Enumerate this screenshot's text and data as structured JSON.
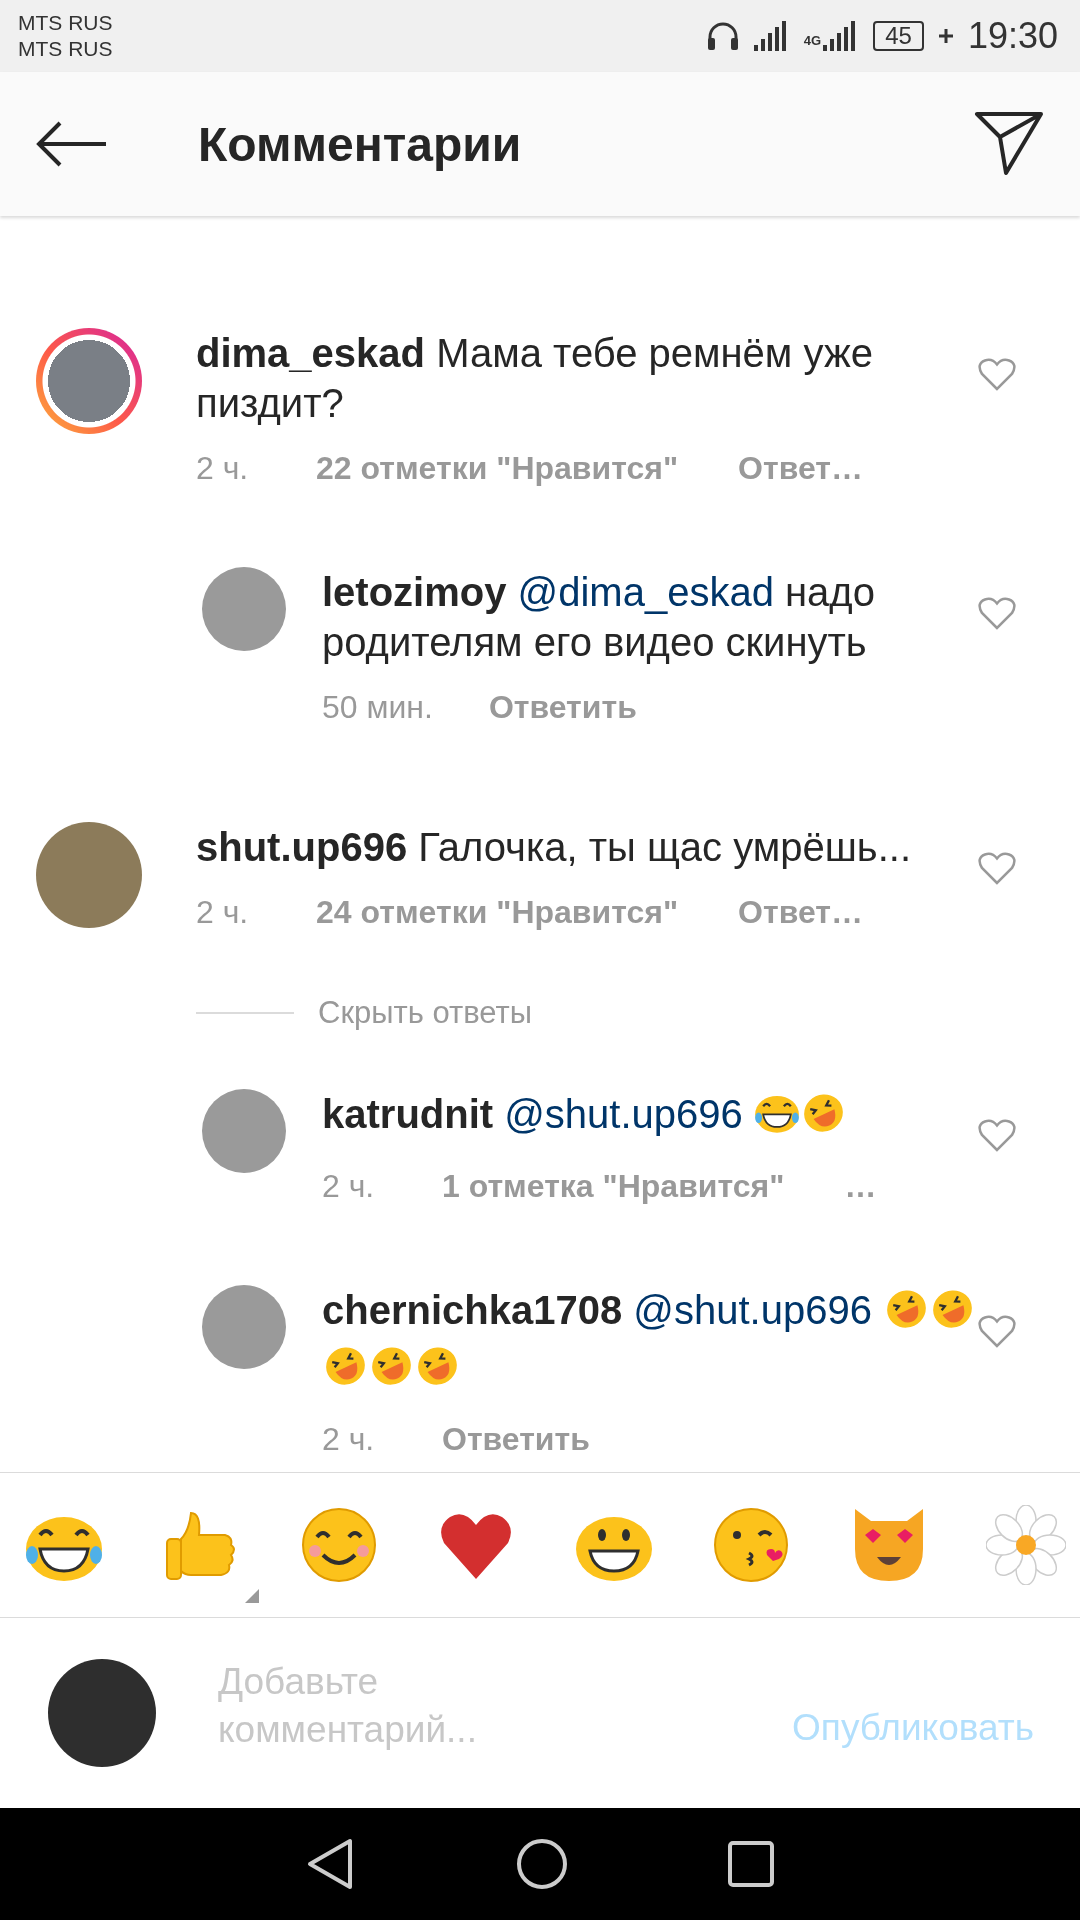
{
  "status_bar": {
    "carriers": [
      "MTS RUS",
      "MTS RUS"
    ],
    "network_type": "4G",
    "battery": "45",
    "time": "19:30"
  },
  "header": {
    "title": "Комментарии"
  },
  "comments": [
    {
      "user": "dima_eskad",
      "text": "Мама тебе ремнём уже пиздит?",
      "time": "2 ч.",
      "likes": "22 отметки \"Нравится\"",
      "reply": "Ответ…",
      "has_story": true,
      "replies": [
        {
          "user": "letozimoy",
          "mention": "@dima_eskad",
          "text": "надо родителям его видео скинуть",
          "time": "50 мин.",
          "reply": "Ответить"
        }
      ]
    },
    {
      "user": "shut.up696",
      "text": "Галочка, ты щас умрёшь...",
      "time": "2 ч.",
      "likes": "24 отметки \"Нравится\"",
      "reply": "Ответ…",
      "has_story": false,
      "hide_replies": "Скрыть ответы",
      "replies": [
        {
          "user": "katrudnit",
          "mention": "@shut.up696",
          "emojis": [
            {
              "kind": "tears-of-joy"
            },
            {
              "kind": "rolling-laughing"
            }
          ],
          "time": "2 ч.",
          "likes": "1 отметка \"Нравится\"",
          "reply": "…"
        },
        {
          "user": "chernichka1708",
          "mention": "@shut.up696",
          "emojis": [
            {
              "kind": "rolling-laughing"
            },
            {
              "kind": "rolling-laughing"
            },
            {
              "kind": "rolling-laughing"
            },
            {
              "kind": "rolling-laughing"
            },
            {
              "kind": "rolling-laughing"
            }
          ],
          "time": "2 ч.",
          "reply": "Ответить"
        }
      ]
    }
  ],
  "emoji_bar": [
    {
      "kind": "tears-of-joy"
    },
    {
      "kind": "thumbs-up"
    },
    {
      "kind": "smiling"
    },
    {
      "kind": "heart"
    },
    {
      "kind": "grinning"
    },
    {
      "kind": "kissing"
    },
    {
      "kind": "heart-eyes-cat"
    },
    {
      "kind": "flower"
    }
  ],
  "composer": {
    "placeholder": "Добавьте комментарий...",
    "post": "Опубликовать",
    "post_disabled": true
  }
}
